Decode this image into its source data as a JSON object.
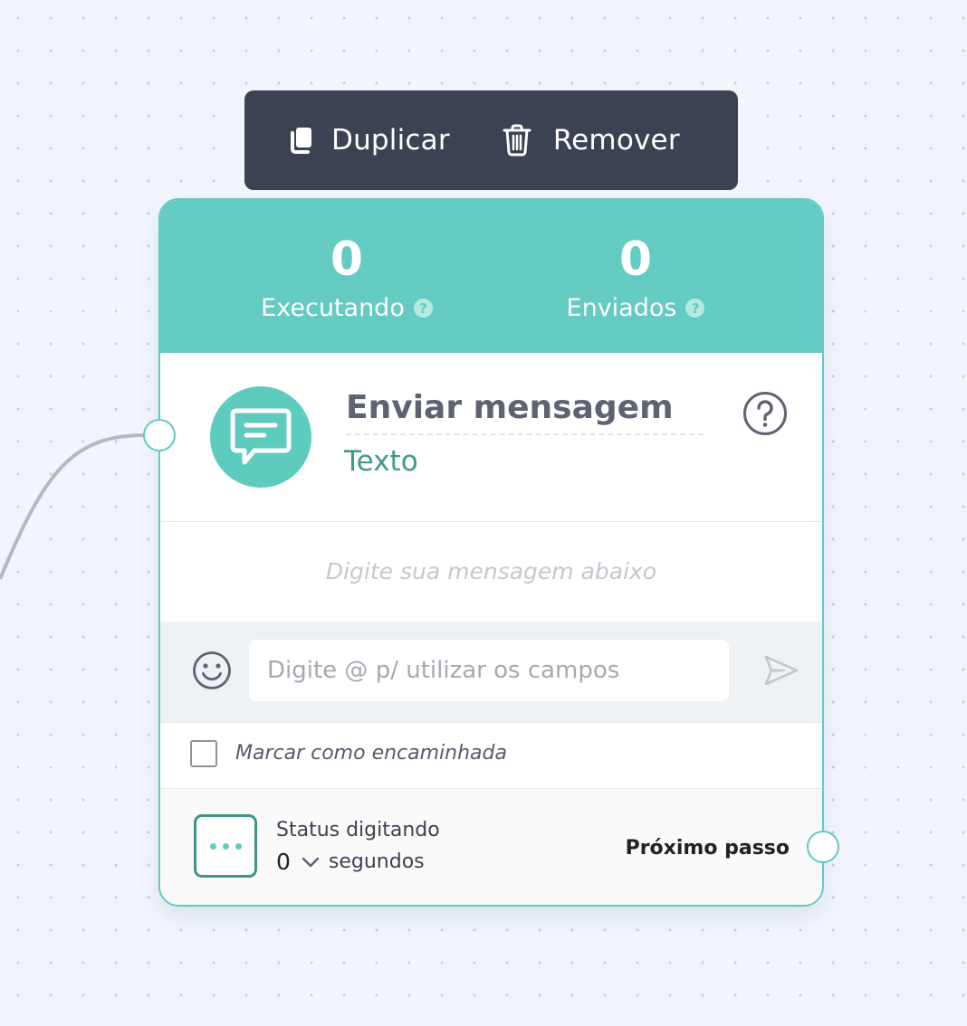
{
  "toolbar": {
    "duplicate_label": "Duplicar",
    "duplicate_icon": "copy-icon",
    "remove_label": "Remover",
    "remove_icon": "trash-icon"
  },
  "stats": {
    "executing": {
      "value": "0",
      "label": "Executando"
    },
    "sent": {
      "value": "0",
      "label": "Enviados"
    }
  },
  "node": {
    "title": "Enviar mensagem",
    "type": "Texto",
    "icon": "message-icon",
    "accent_color": "#63cbc1"
  },
  "message": {
    "placeholder": "Digite sua mensagem abaixo"
  },
  "input": {
    "placeholder": "Digite @ p/ utilizar os campos",
    "value": ""
  },
  "forward": {
    "label": "Marcar como encaminhada",
    "checked": false
  },
  "typing_status": {
    "label": "Status digitando",
    "value": "0",
    "unit": "segundos"
  },
  "next_step": {
    "label": "Próximo passo"
  }
}
